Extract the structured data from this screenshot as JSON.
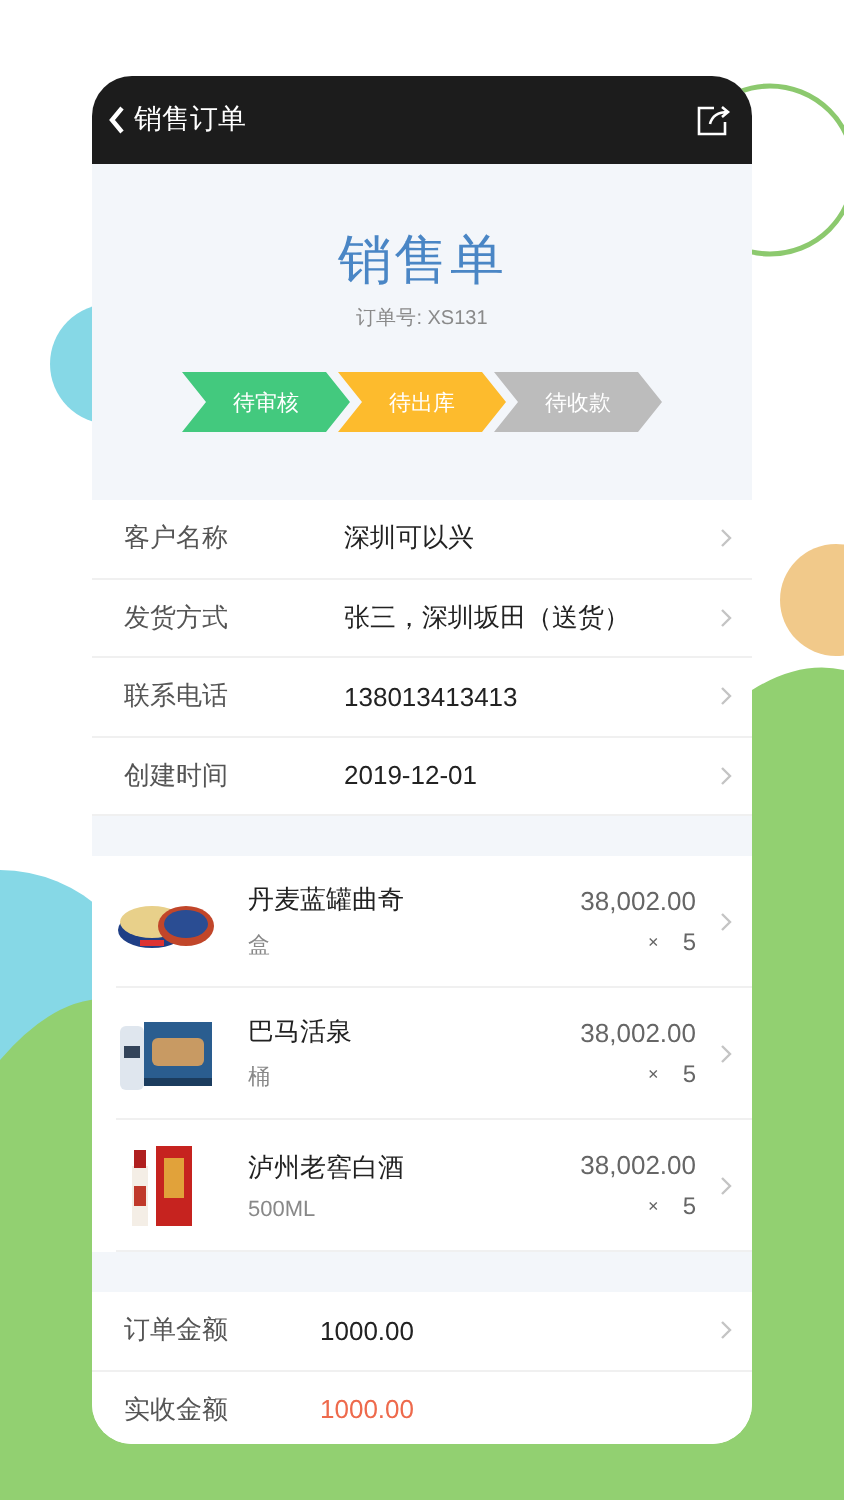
{
  "header": {
    "back_label": "销售订单"
  },
  "order": {
    "title": "销售单",
    "number": "订单号: XS131"
  },
  "steps": [
    {
      "label": "待审核",
      "color": "#43c97e"
    },
    {
      "label": "待出库",
      "color": "#fdbb2d"
    },
    {
      "label": "待收款",
      "color": "#bcbcbc"
    }
  ],
  "info_rows": [
    {
      "label": "客户名称",
      "value": "深圳可以兴"
    },
    {
      "label": "发货方式",
      "value": "张三，深圳坂田（送货）"
    },
    {
      "label": "联系电话",
      "value": "138013413413"
    },
    {
      "label": "创建时间",
      "value": "2019-12-01"
    }
  ],
  "products": [
    {
      "name": "丹麦蓝罐曲奇",
      "unit": "盒",
      "price": "38,002.00",
      "times": "×",
      "quantity": "5"
    },
    {
      "name": "巴马活泉",
      "unit": "桶",
      "price": "38,002.00",
      "times": "×",
      "quantity": "5"
    },
    {
      "name": "泸州老窖白酒",
      "unit": "500ML",
      "price": "38,002.00",
      "times": "×",
      "quantity": "5"
    }
  ],
  "summary": [
    {
      "label": "订单金额",
      "value": "1000.00",
      "kind": "plain",
      "chevron": true
    },
    {
      "label": "实收金额",
      "value": "1000.00",
      "kind": "emphasis",
      "chevron": false
    }
  ]
}
